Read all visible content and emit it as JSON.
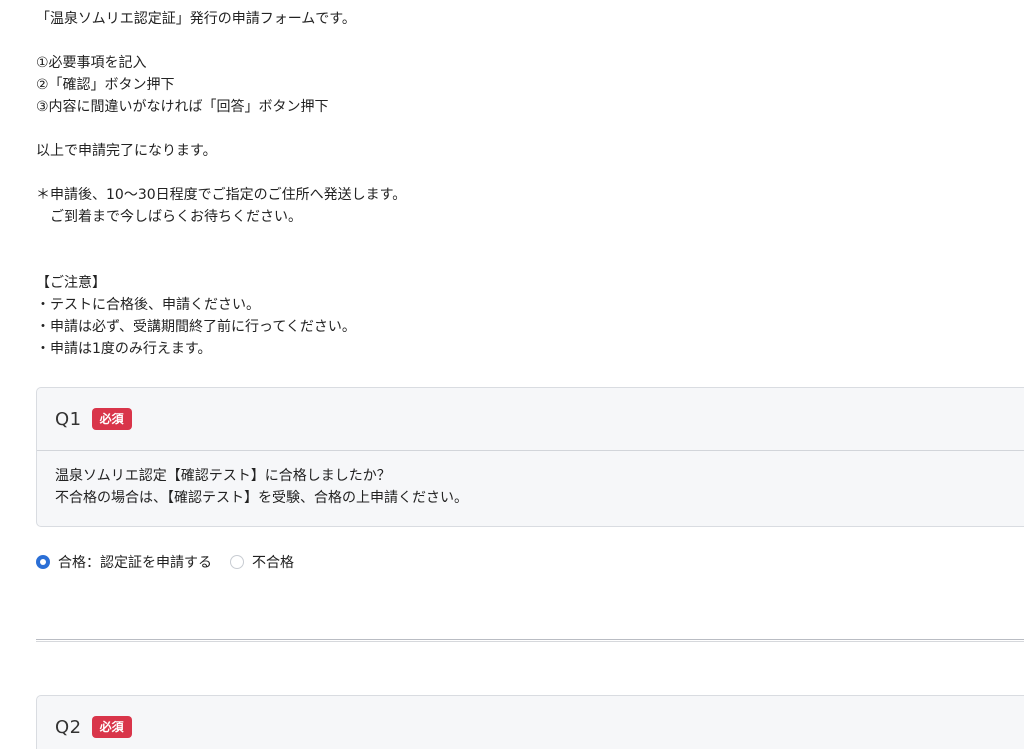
{
  "intro": {
    "line1": "「温泉ソムリエ認定証」発行の申請フォームです。",
    "steps": [
      "①必要事項を記入",
      "②「確認」ボタン押下",
      "③内容に間違いがなければ「回答」ボタン押下"
    ],
    "complete": "以上で申請完了になります。",
    "shipping_line1": "＊申請後、10〜30日程度でご指定のご住所へ発送します。",
    "shipping_line2": "　ご到着まで今しばらくお待ちください。",
    "notice_title": "【ご注意】",
    "notices": [
      "・テストに合格後、申請ください。",
      "・申請は必ず、受講期間終了前に行ってください。",
      "・申請は1度のみ行えます。"
    ]
  },
  "questions": [
    {
      "number": "Q1",
      "badge": "必須",
      "text_line1": "温泉ソムリエ認定【確認テスト】に合格しましたか？",
      "text_line2": "不合格の場合は、【確認テスト】を受験、合格の上申請ください。",
      "options": [
        {
          "label": "合格：認定証を申請する",
          "selected": true
        },
        {
          "label": "不合格",
          "selected": false
        }
      ]
    },
    {
      "number": "Q2",
      "badge": "必須"
    }
  ],
  "colors": {
    "badge": "#d9354a",
    "radio_selected": "#2b6fd6",
    "card_bg": "#f6f7f9"
  }
}
